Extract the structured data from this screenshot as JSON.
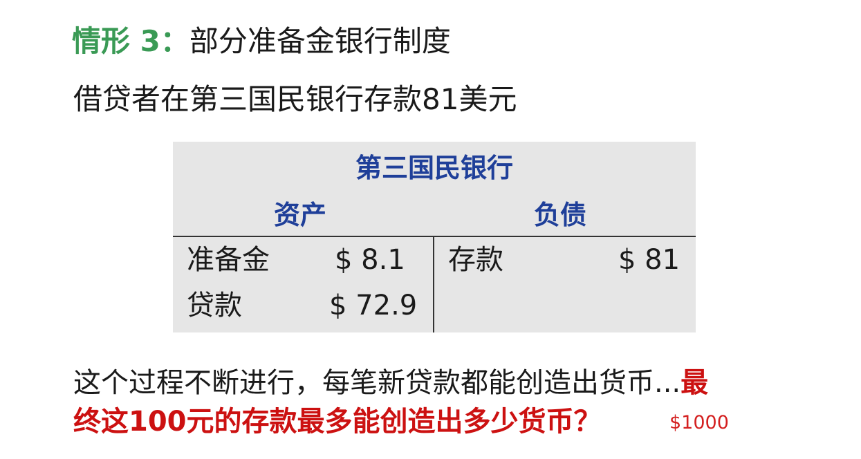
{
  "title": {
    "label": "情形 3：",
    "text": "部分准备金银行制度"
  },
  "subtitle": "借贷者在第三国民银行存款81美元",
  "t_account": {
    "bank_name": "第三国民银行",
    "assets_header": "资产",
    "liabilities_header": "负债",
    "assets": [
      {
        "label": "准备金",
        "value": "$ 8.1"
      },
      {
        "label": "贷款",
        "value": "$ 72.9"
      }
    ],
    "liabilities": [
      {
        "label": "存款",
        "value": "$ 81"
      }
    ]
  },
  "bottom": {
    "line1_normal": "这个过程不断进行，每笔新贷款都能创造出货币...",
    "line1_red": "最",
    "line2_red": "终这100元的存款最多能创造出多少货币？"
  },
  "answer": "$1000",
  "colors": {
    "title_label": "#3a9a55",
    "bank_header": "#1f3f99",
    "emphasis_red": "#cc1111",
    "table_bg": "#e6e6e6"
  }
}
